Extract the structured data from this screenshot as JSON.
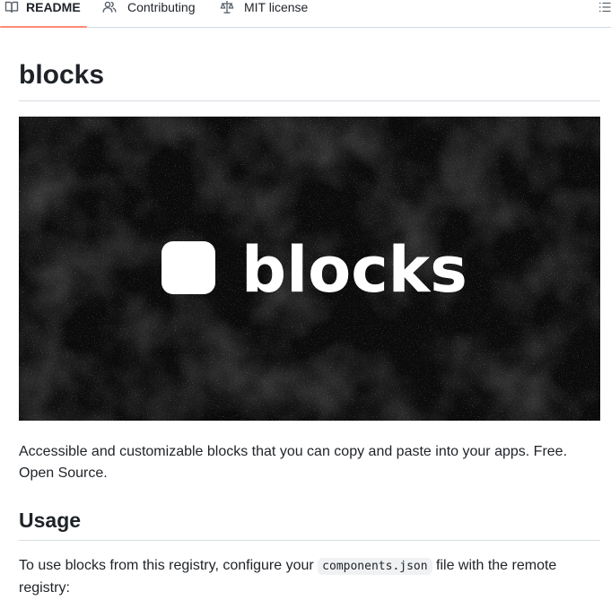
{
  "tabs": [
    {
      "label": "README",
      "icon": "book-icon",
      "active": true
    },
    {
      "label": "Contributing",
      "icon": "people-icon",
      "active": false
    },
    {
      "label": "MIT license",
      "icon": "law-icon",
      "active": false
    }
  ],
  "outline_icon": "list-unordered-icon",
  "readme": {
    "title": "blocks",
    "banner_text": "blocks",
    "intro": "Accessible and customizable blocks that you can copy and paste into your apps. Free. Open Source.",
    "usage_heading": "Usage",
    "usage_text_before": "To use blocks from this registry, configure your ",
    "usage_code": "components.json",
    "usage_text_after": " file with the remote registry:"
  },
  "colors": {
    "active_tab_underline": "#fd8c73",
    "banner_background": "#0b0b0b",
    "text": "#1f2328",
    "code_background": "#eff1f3"
  }
}
